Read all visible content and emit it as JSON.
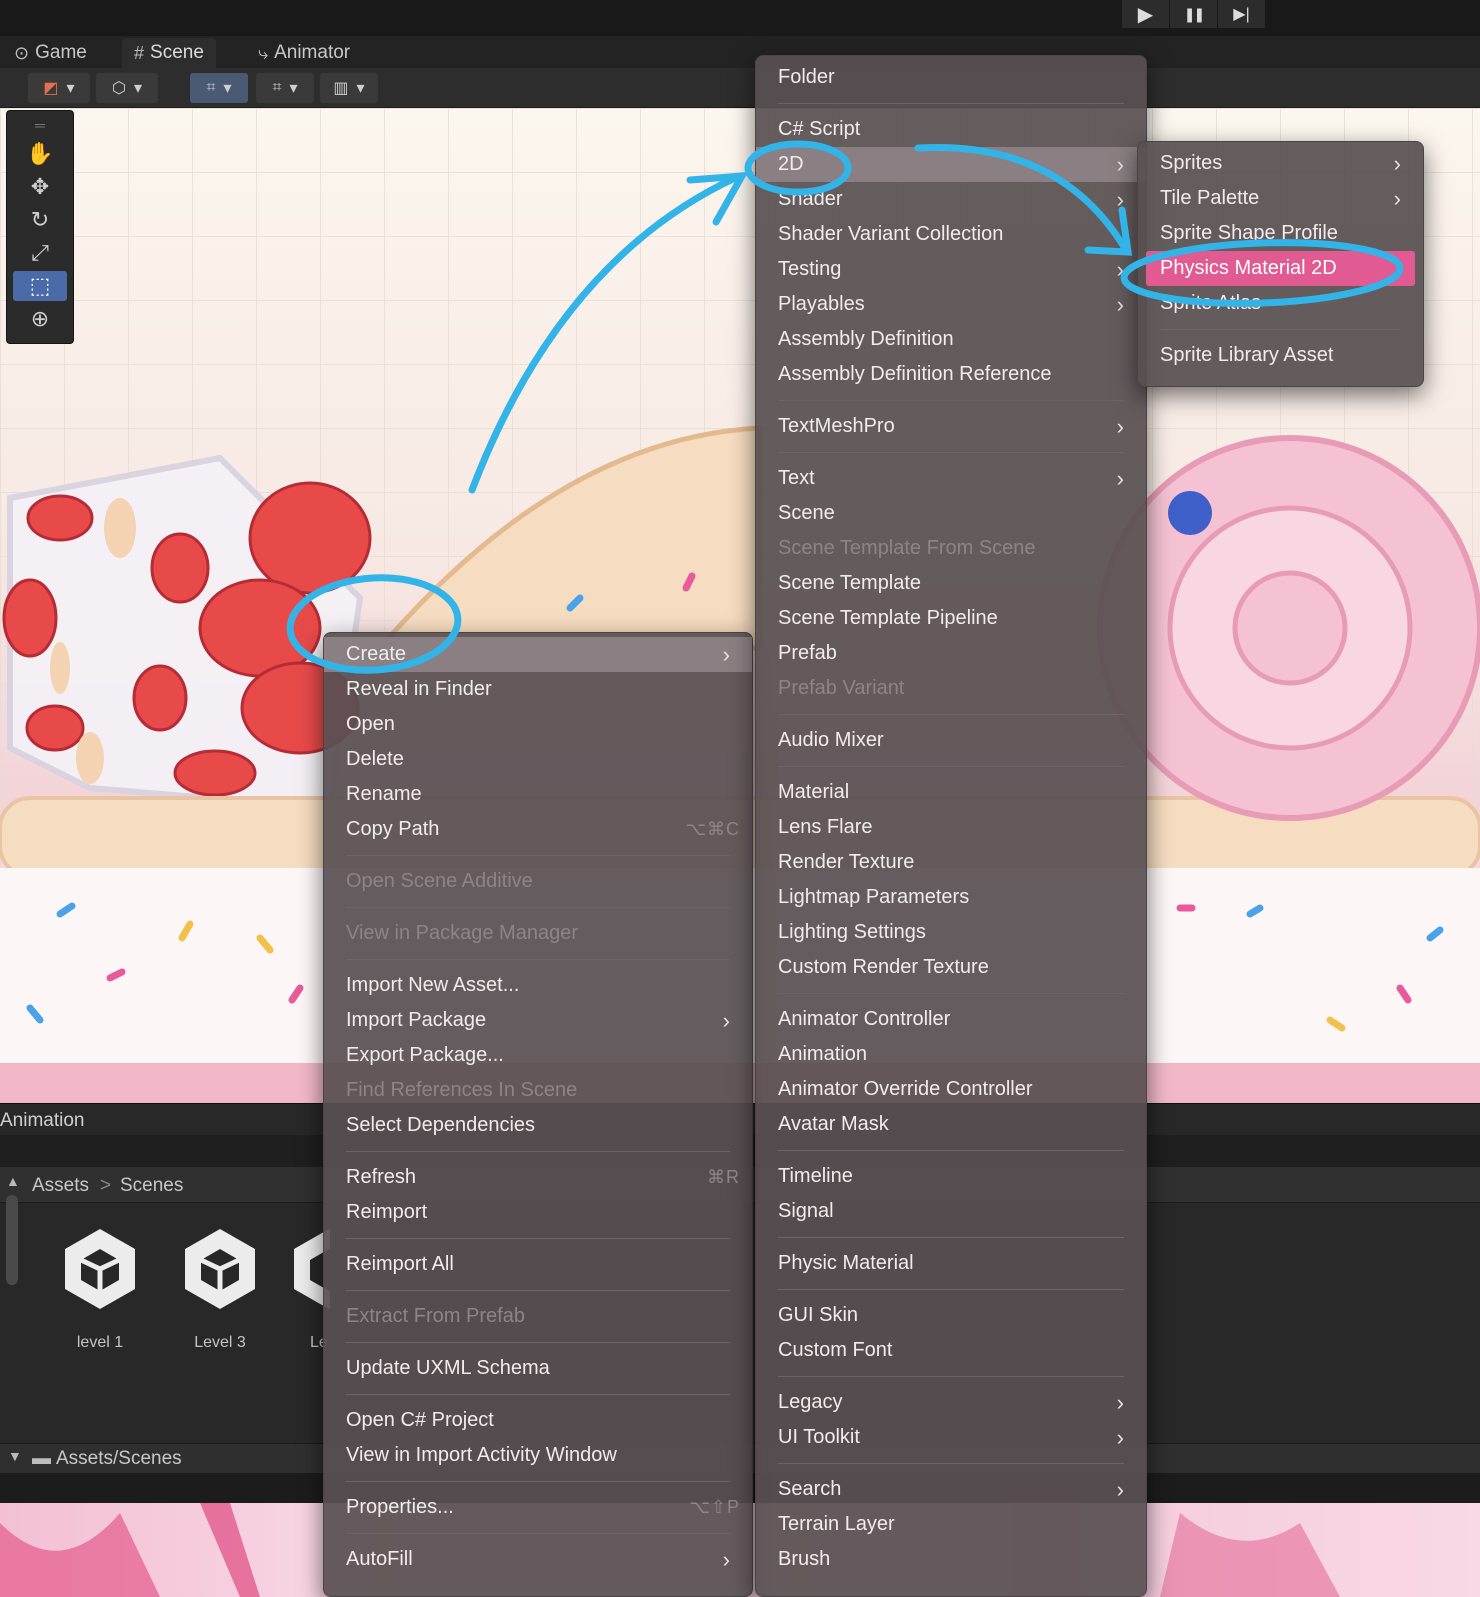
{
  "toolbar_play": {
    "play": "▶",
    "pause": "❚❚",
    "step": "▶|"
  },
  "tabs": [
    {
      "label": "Game",
      "icon": "gamepad-icon"
    },
    {
      "label": "Scene",
      "icon": "grid-hash-icon"
    },
    {
      "label": "Animator",
      "icon": "animator-icon"
    }
  ],
  "panels": {
    "animation_title": "Animation",
    "breadcrumb": {
      "root": "Assets",
      "sep": ">",
      "current": "Scenes"
    },
    "assets": [
      {
        "label": "level 1"
      },
      {
        "label": "Level 3"
      },
      {
        "label": "Le"
      }
    ],
    "path_label": "Assets/Scenes"
  },
  "context_menu": {
    "items": [
      {
        "label": "Create",
        "submenu": true,
        "highlighted": true
      },
      {
        "label": "Reveal in Finder"
      },
      {
        "label": "Open"
      },
      {
        "label": "Delete"
      },
      {
        "label": "Rename"
      },
      {
        "label": "Copy Path",
        "shortcut": "⌥⌘C"
      },
      {
        "separator": true
      },
      {
        "label": "Open Scene Additive",
        "disabled": true
      },
      {
        "separator": true
      },
      {
        "label": "View in Package Manager",
        "disabled": true
      },
      {
        "separator": true
      },
      {
        "label": "Import New Asset..."
      },
      {
        "label": "Import Package",
        "submenu": true
      },
      {
        "label": "Export Package..."
      },
      {
        "label": "Find References In Scene",
        "disabled": true
      },
      {
        "label": "Select Dependencies"
      },
      {
        "separator": true
      },
      {
        "label": "Refresh",
        "shortcut": "⌘R"
      },
      {
        "label": "Reimport"
      },
      {
        "separator": true
      },
      {
        "label": "Reimport All"
      },
      {
        "separator": true
      },
      {
        "label": "Extract From Prefab",
        "disabled": true
      },
      {
        "separator": true
      },
      {
        "label": "Update UXML Schema"
      },
      {
        "separator": true
      },
      {
        "label": "Open C# Project"
      },
      {
        "label": "View in Import Activity Window"
      },
      {
        "separator": true
      },
      {
        "label": "Properties...",
        "shortcut": "⌥⇧P"
      },
      {
        "separator": true
      },
      {
        "label": "AutoFill",
        "submenu": true
      }
    ]
  },
  "create_menu": {
    "items": [
      {
        "label": "Folder"
      },
      {
        "separator": true
      },
      {
        "label": "C# Script"
      },
      {
        "label": "2D",
        "submenu": true,
        "highlighted": true
      },
      {
        "label": "Shader",
        "submenu": true
      },
      {
        "label": "Shader Variant Collection"
      },
      {
        "label": "Testing",
        "submenu": true
      },
      {
        "label": "Playables",
        "submenu": true
      },
      {
        "label": "Assembly Definition"
      },
      {
        "label": "Assembly Definition Reference"
      },
      {
        "separator": true
      },
      {
        "label": "TextMeshPro",
        "submenu": true
      },
      {
        "separator": true
      },
      {
        "label": "Text",
        "submenu": true
      },
      {
        "label": "Scene"
      },
      {
        "label": "Scene Template From Scene",
        "disabled": true
      },
      {
        "label": "Scene Template"
      },
      {
        "label": "Scene Template Pipeline"
      },
      {
        "label": "Prefab"
      },
      {
        "label": "Prefab Variant",
        "disabled": true
      },
      {
        "separator": true
      },
      {
        "label": "Audio Mixer"
      },
      {
        "separator": true
      },
      {
        "label": "Material"
      },
      {
        "label": "Lens Flare"
      },
      {
        "label": "Render Texture"
      },
      {
        "label": "Lightmap Parameters"
      },
      {
        "label": "Lighting Settings"
      },
      {
        "label": "Custom Render Texture"
      },
      {
        "separator": true
      },
      {
        "label": "Animator Controller"
      },
      {
        "label": "Animation"
      },
      {
        "label": "Animator Override Controller"
      },
      {
        "label": "Avatar Mask"
      },
      {
        "separator": true
      },
      {
        "label": "Timeline"
      },
      {
        "label": "Signal"
      },
      {
        "separator": true
      },
      {
        "label": "Physic Material"
      },
      {
        "separator": true
      },
      {
        "label": "GUI Skin"
      },
      {
        "label": "Custom Font"
      },
      {
        "separator": true
      },
      {
        "label": "Legacy",
        "submenu": true
      },
      {
        "label": "UI Toolkit",
        "submenu": true
      },
      {
        "separator": true
      },
      {
        "label": "Search",
        "submenu": true
      },
      {
        "label": "Terrain Layer"
      },
      {
        "label": "Brush"
      }
    ]
  },
  "submenu_2d": {
    "items": [
      {
        "label": "Sprites",
        "submenu": true
      },
      {
        "label": "Tile Palette",
        "submenu": true
      },
      {
        "label": "Sprite Shape Profile"
      },
      {
        "label": "Physics Material 2D",
        "selected": true
      },
      {
        "label": "Sprite Atlas"
      },
      {
        "separator": true
      },
      {
        "label": "Sprite Library Asset"
      }
    ]
  },
  "colors": {
    "annotation": "#32b4e8",
    "selection": "#e15a91",
    "menu_bg": "#585052",
    "menu_highlight": "#8a8083"
  }
}
